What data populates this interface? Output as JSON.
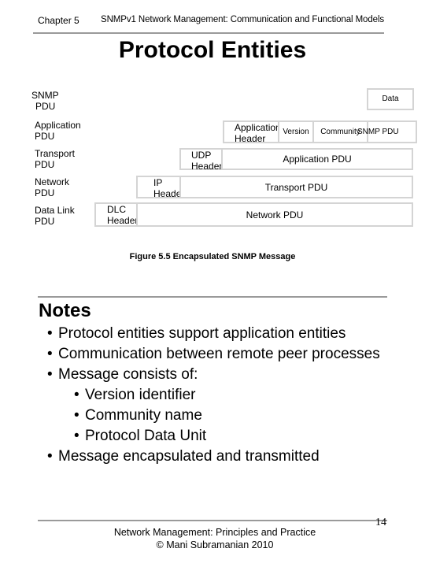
{
  "header": {
    "chapter": "Chapter 5",
    "chapter_title": "SNMPv1 Network Management: Communication and Functional Models"
  },
  "page_title": "Protocol Entities",
  "diagram": {
    "layer_labels": [
      [
        "SNMP",
        "PDU"
      ],
      [
        "Application",
        "PDU"
      ],
      [
        "Transport",
        "PDU"
      ],
      [
        "Network",
        "PDU"
      ],
      [
        "Data Link",
        "PDU"
      ]
    ],
    "data_box": "Data",
    "app_header": [
      "Application",
      "Header"
    ],
    "version": "Version",
    "community": "Community",
    "snmp_pdu": "SNMP PDU",
    "udp_header": [
      "UDP",
      "Header"
    ],
    "application_pdu": "Application PDU",
    "ip_header": [
      "IP",
      "Header"
    ],
    "transport_pdu": "Transport PDU",
    "dlc_header": [
      "DLC",
      "Header"
    ],
    "network_pdu": "Network PDU",
    "caption": "Figure 5.5 Encapsulated SNMP Message"
  },
  "notes": {
    "title": "Notes",
    "items": [
      "Protocol entities support application entities",
      "Communication between remote peer processes",
      "Message consists of:"
    ],
    "sub_items": [
      "Version identifier",
      "Community name",
      "Protocol Data Unit"
    ],
    "last_item": "Message encapsulated and transmitted",
    "bullet": "•"
  },
  "footer": {
    "line1": "Network Management: Principles and Practice",
    "line2": "© Mani Subramanian 2010",
    "page_number": "14"
  }
}
